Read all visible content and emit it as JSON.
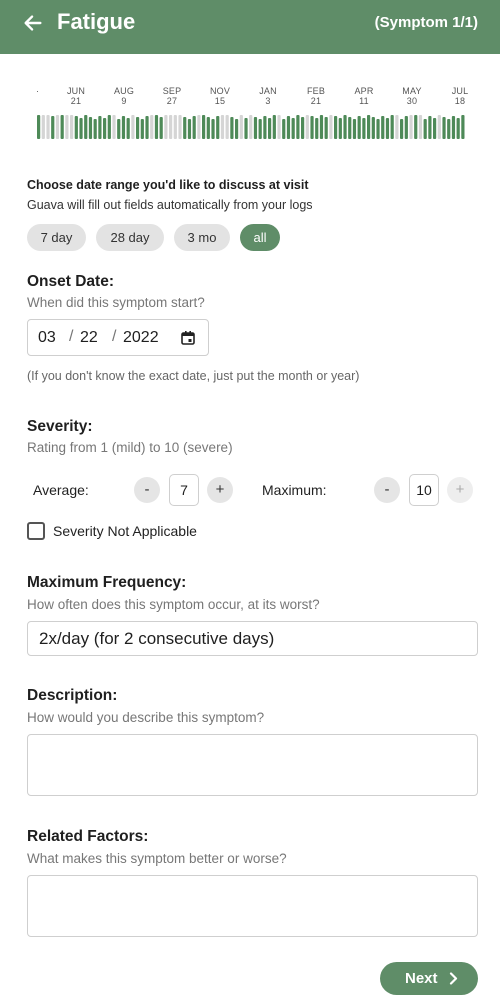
{
  "header": {
    "title": "Fatigue",
    "counter": "(Symptom 1/1)"
  },
  "timeline": {
    "dot": "·",
    "months": [
      {
        "m": "JUN",
        "d": "21"
      },
      {
        "m": "AUG",
        "d": "9"
      },
      {
        "m": "SEP",
        "d": "27"
      },
      {
        "m": "NOV",
        "d": "15"
      },
      {
        "m": "JAN",
        "d": "3"
      },
      {
        "m": "FEB",
        "d": "21"
      },
      {
        "m": "APR",
        "d": "11"
      },
      {
        "m": "MAY",
        "d": "30"
      },
      {
        "m": "JUL",
        "d": "18"
      }
    ],
    "colors": {
      "logged": "#4e8a58",
      "empty": "#d5d5d5"
    },
    "levels": [
      1,
      0,
      0,
      1,
      0,
      1,
      0,
      0,
      1,
      1,
      1,
      1,
      1,
      1,
      1,
      1,
      0,
      1,
      1,
      1,
      0,
      1,
      1,
      1,
      0,
      1,
      1,
      0,
      0,
      0,
      0,
      1,
      1,
      1,
      0,
      1,
      1,
      1,
      1,
      0,
      0,
      1,
      1,
      0,
      1,
      0,
      1,
      1,
      1,
      1,
      1,
      0,
      1,
      1,
      1,
      1,
      1,
      0,
      1,
      1,
      1,
      1,
      0,
      1,
      1,
      1,
      1,
      1,
      1,
      1,
      1,
      1,
      1,
      1,
      1,
      1,
      0,
      1,
      1,
      0,
      1,
      0,
      1,
      1,
      1,
      0,
      1,
      1,
      1,
      1,
      1
    ]
  },
  "date_range": {
    "title": "Choose date range you'd like to discuss at visit",
    "subtitle": "Guava will fill out fields automatically from your logs",
    "options": [
      "7 day",
      "28 day",
      "3 mo",
      "all"
    ],
    "selected": "all"
  },
  "onset": {
    "label": "Onset Date:",
    "help": "When did this symptom start?",
    "month": "03",
    "day": "22",
    "year": "2022",
    "note": "(If you don't know the exact date, just put the month or year)"
  },
  "severity": {
    "label": "Severity:",
    "help": "Rating from 1 (mild) to 10 (severe)",
    "average_label": "Average:",
    "average_value": "7",
    "maximum_label": "Maximum:",
    "maximum_value": "10",
    "minus": "-",
    "plus": "+",
    "not_applicable_label": "Severity Not Applicable"
  },
  "frequency": {
    "label": "Maximum Frequency:",
    "help": "How often does this symptom occur, at its worst?",
    "value": "2x/day (for 2 consecutive days)"
  },
  "description": {
    "label": "Description:",
    "help": "How would you describe this symptom?",
    "value": ""
  },
  "related": {
    "label": "Related Factors:",
    "help": "What makes this symptom better or worse?",
    "value": ""
  },
  "footer": {
    "next_label": "Next"
  }
}
